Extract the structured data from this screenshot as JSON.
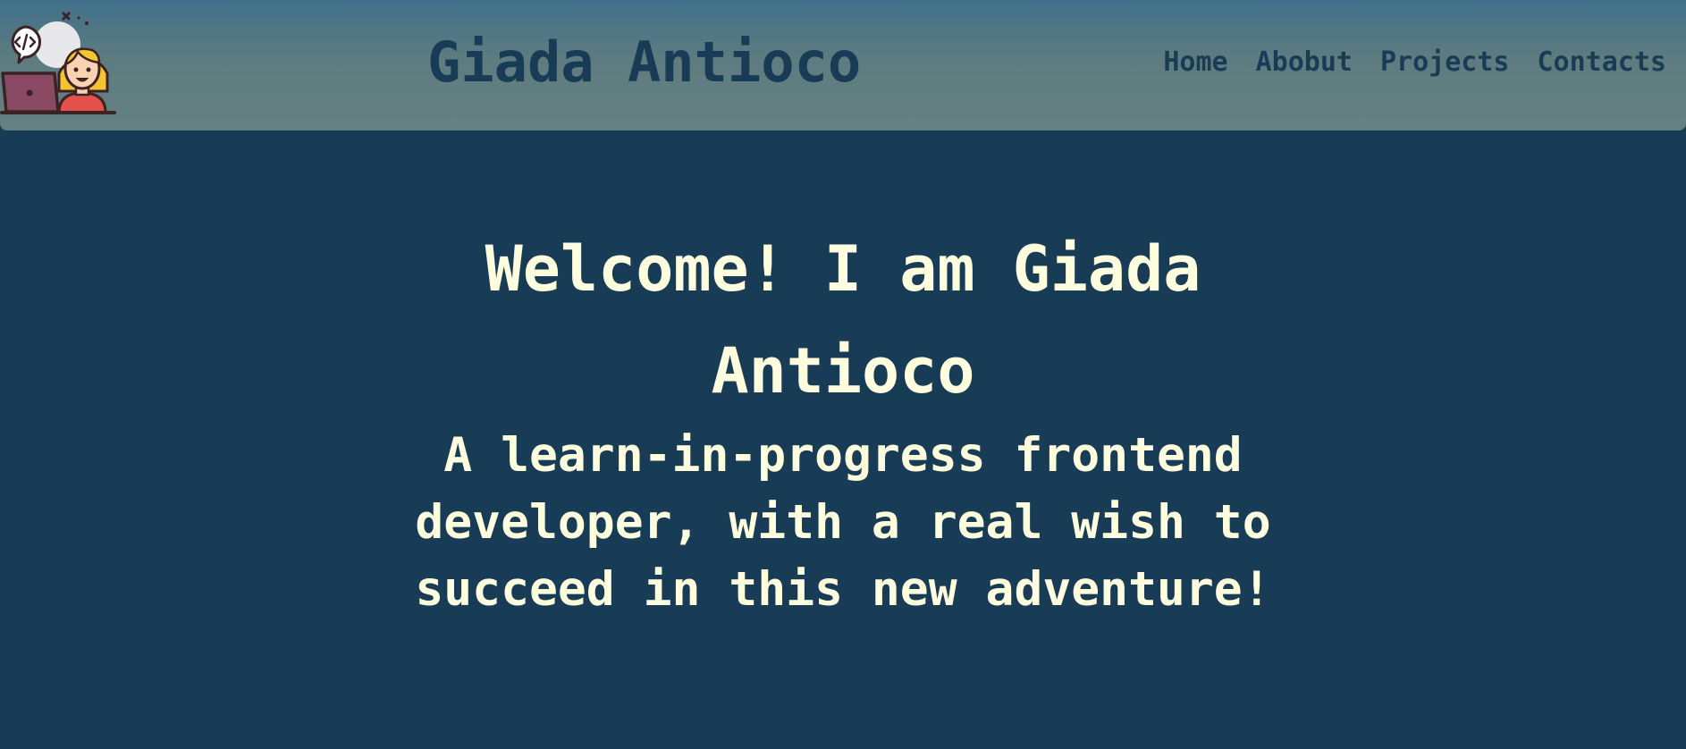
{
  "header": {
    "logo_icon": "developer-avatar-icon",
    "title": "Giada Antioco",
    "nav": [
      {
        "label": "Home"
      },
      {
        "label": "Abobut"
      },
      {
        "label": "Projects"
      },
      {
        "label": "Contacts"
      }
    ]
  },
  "hero": {
    "heading": "Welcome! I am Giada Antioco",
    "subheading": "A learn-in-progress frontend developer, with a real wish to succeed in this new adventure!"
  },
  "colors": {
    "background": "#193c56",
    "header_top": "#3f7089",
    "header_bottom": "#648082",
    "text_light": "#fefedf",
    "text_dark": "#193c56"
  }
}
